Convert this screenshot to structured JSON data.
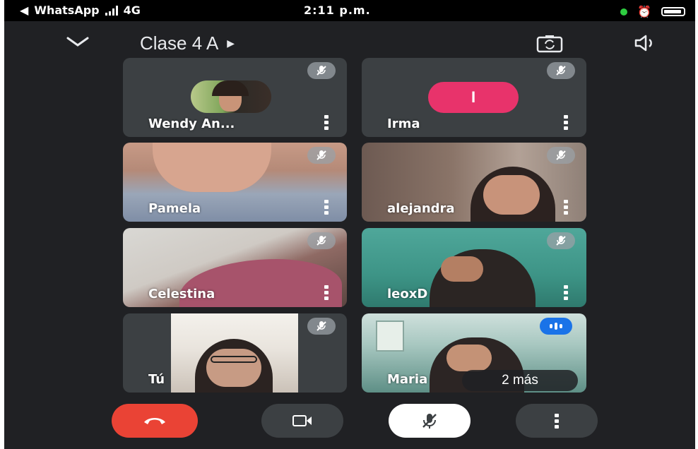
{
  "status": {
    "carrier": "WhatsApp",
    "network": "4G",
    "time": "2:11 p.m."
  },
  "call": {
    "title": "Clase 4 A"
  },
  "participants": [
    {
      "name": "Wendy An...",
      "muted": true,
      "avatar": "photo"
    },
    {
      "name": "Irma",
      "muted": true,
      "avatar_letter": "I"
    },
    {
      "name": "Pamela",
      "muted": true
    },
    {
      "name": "alejandra",
      "muted": true
    },
    {
      "name": "Celestina",
      "muted": true
    },
    {
      "name": "leoxD",
      "muted": true
    },
    {
      "name": "Tú",
      "muted": true
    },
    {
      "name": "Maria",
      "muted": false,
      "speaking": true
    }
  ],
  "overflow": {
    "label": "2 más"
  },
  "colors": {
    "background": "#202124",
    "tile": "#3c4043",
    "end_call": "#ea4335",
    "avatar_irma": "#e8336b",
    "speaking": "#1a73e8"
  }
}
